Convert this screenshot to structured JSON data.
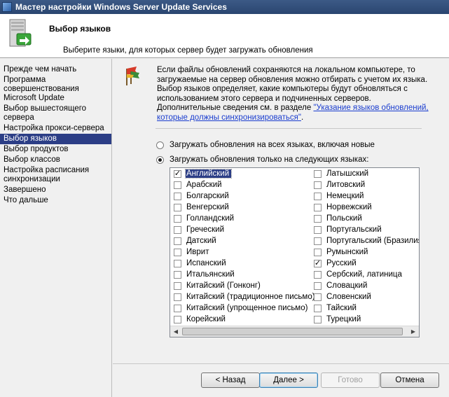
{
  "window": {
    "title": "Мастер настройки Windows Server Update Services"
  },
  "header": {
    "title": "Выбор языков",
    "subtitle": "Выберите языки, для которых сервер будет загружать обновления"
  },
  "sidebar": {
    "items": [
      {
        "label": "Прежде чем начать",
        "active": false
      },
      {
        "label": "Программа совершенствования Microsoft Update",
        "active": false
      },
      {
        "label": "Выбор вышестоящего сервера",
        "active": false
      },
      {
        "label": "Настройка прокси-сервера",
        "active": false
      },
      {
        "label": "Выбор языков",
        "active": true
      },
      {
        "label": "Выбор продуктов",
        "active": false
      },
      {
        "label": "Выбор классов",
        "active": false
      },
      {
        "label": "Настройка расписания синхронизации",
        "active": false
      },
      {
        "label": "Завершено",
        "active": false
      },
      {
        "label": "Что дальше",
        "active": false
      }
    ]
  },
  "info": {
    "text": "Если файлы обновлений сохраняются на локальном компьютере, то загружаемые на сервер обновления можно отбирать с учетом их языка. Выбор языков определяет, какие компьютеры будут обновляться с использованием этого сервера и подчиненных серверов. Дополнительные сведения см. в разделе ",
    "link": "\"Указание языков обновлений, которые должны синхронизироваться\"",
    "suffix": "."
  },
  "options": {
    "all_languages": {
      "label": "Загружать обновления на всех языках, включая новые",
      "selected": false
    },
    "only_languages": {
      "label": "Загружать обновления только на следующих языках:",
      "selected": true
    }
  },
  "languages": {
    "left": [
      {
        "label": "Английский",
        "checked": true,
        "selected": true
      },
      {
        "label": "Арабский",
        "checked": false
      },
      {
        "label": "Болгарский",
        "checked": false
      },
      {
        "label": "Венгерский",
        "checked": false
      },
      {
        "label": "Голландский",
        "checked": false
      },
      {
        "label": "Греческий",
        "checked": false
      },
      {
        "label": "Датский",
        "checked": false
      },
      {
        "label": "Иврит",
        "checked": false
      },
      {
        "label": "Испанский",
        "checked": false
      },
      {
        "label": "Итальянский",
        "checked": false
      },
      {
        "label": "Китайский (Гонконг)",
        "checked": false
      },
      {
        "label": "Китайский (традиционное письмо)",
        "checked": false
      },
      {
        "label": "Китайский (упрощенное письмо)",
        "checked": false
      },
      {
        "label": "Корейский",
        "checked": false
      }
    ],
    "right": [
      {
        "label": "Латышский",
        "checked": false
      },
      {
        "label": "Литовский",
        "checked": false
      },
      {
        "label": "Немецкий",
        "checked": false
      },
      {
        "label": "Норвежский",
        "checked": false
      },
      {
        "label": "Польский",
        "checked": false
      },
      {
        "label": "Португальский",
        "checked": false
      },
      {
        "label": "Португальский (Бразилия)",
        "checked": false
      },
      {
        "label": "Румынский",
        "checked": false
      },
      {
        "label": "Русский",
        "checked": true
      },
      {
        "label": "Сербский, латиница",
        "checked": false
      },
      {
        "label": "Словацкий",
        "checked": false
      },
      {
        "label": "Словенский",
        "checked": false
      },
      {
        "label": "Тайский",
        "checked": false
      },
      {
        "label": "Турецкий",
        "checked": false
      }
    ]
  },
  "buttons": {
    "back": "< Назад",
    "next": "Далее >",
    "finish": "Готово",
    "cancel": "Отмена"
  },
  "colors": {
    "titlebar": "#2f4d7a",
    "selection": "#2c3e86",
    "link": "#1a3dcf"
  }
}
